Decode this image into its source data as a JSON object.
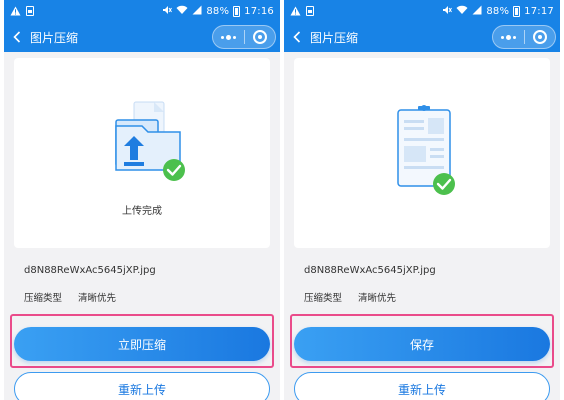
{
  "colors": {
    "primary": "#1883e6",
    "highlight_border": "#ea4b8a",
    "success_green": "#4cc04d",
    "illustration_blue": "#2f8fe8"
  },
  "left": {
    "status": {
      "battery": "88%",
      "time": "17:16"
    },
    "nav": {
      "title": "图片压缩"
    },
    "card": {
      "caption": "上传完成"
    },
    "file": {
      "name": "d8N88ReWxAc5645jXP.jpg"
    },
    "meta": {
      "label": "压缩类型",
      "value": "清晰优先"
    },
    "primary_button": "立即压缩",
    "secondary_button": "重新上传"
  },
  "right": {
    "status": {
      "battery": "88%",
      "time": "17:17"
    },
    "nav": {
      "title": "图片压缩"
    },
    "file": {
      "name": "d8N88ReWxAc5645jXP.jpg"
    },
    "meta": {
      "label": "压缩类型",
      "value": "清晰优先"
    },
    "primary_button": "保存",
    "secondary_button": "重新上传"
  },
  "icons": {
    "status_left": [
      "warning-icon",
      "sim-icon"
    ],
    "status_right": [
      "mute-icon",
      "wifi-icon",
      "signal-icon",
      "battery-icon"
    ],
    "nav": [
      "back-icon",
      "more-dots-icon",
      "close-target-icon"
    ],
    "illustrations": [
      "upload-folder-icon",
      "document-icon",
      "check-circle-icon"
    ]
  }
}
